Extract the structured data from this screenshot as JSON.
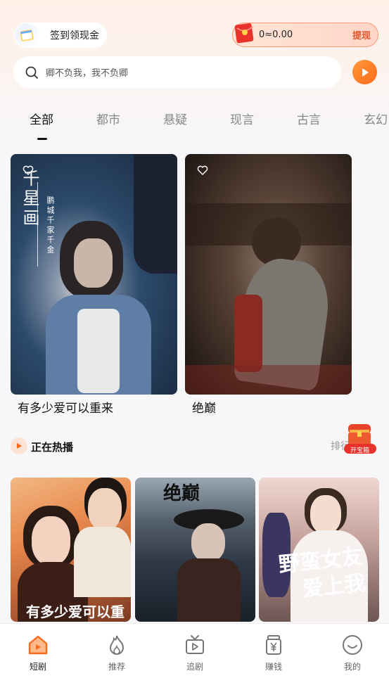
{
  "header": {
    "checkin_label": "签到领现金",
    "wallet_amount": "0≈0.00",
    "withdraw_label": "提现"
  },
  "search": {
    "placeholder": "卿不负我，我不负卿"
  },
  "tabs": [
    {
      "label": "全部",
      "active": true
    },
    {
      "label": "都市",
      "active": false
    },
    {
      "label": "悬疑",
      "active": false
    },
    {
      "label": "现言",
      "active": false
    },
    {
      "label": "古言",
      "active": false
    },
    {
      "label": "玄幻",
      "active": false
    }
  ],
  "featured": [
    {
      "caption": "有多少爱可以重来",
      "poster_title": "千星画",
      "poster_sub": "鹏城千家千金"
    },
    {
      "caption": "绝巅"
    }
  ],
  "hot_section": {
    "title": "正在热播",
    "rank_label": "排行榜",
    "chest_label": "开宝箱",
    "items": [
      {
        "poster_title": "有多少爱可以重来"
      },
      {
        "poster_title": "绝巅"
      },
      {
        "poster_title_line1": "野蛮女友",
        "poster_title_line2": "爱上我"
      }
    ]
  },
  "bottom_nav": [
    {
      "label": "短剧",
      "icon": "home-tv-icon",
      "active": true
    },
    {
      "label": "推荐",
      "icon": "flame-icon",
      "active": false
    },
    {
      "label": "追剧",
      "icon": "tv-play-icon",
      "active": false
    },
    {
      "label": "赚钱",
      "icon": "money-jar-icon",
      "active": false
    },
    {
      "label": "我的",
      "icon": "smile-face-icon",
      "active": false
    }
  ],
  "colors": {
    "accent": "#ff6a1a",
    "withdraw": "#e8552a",
    "active_nav": "#ff6a1a"
  }
}
